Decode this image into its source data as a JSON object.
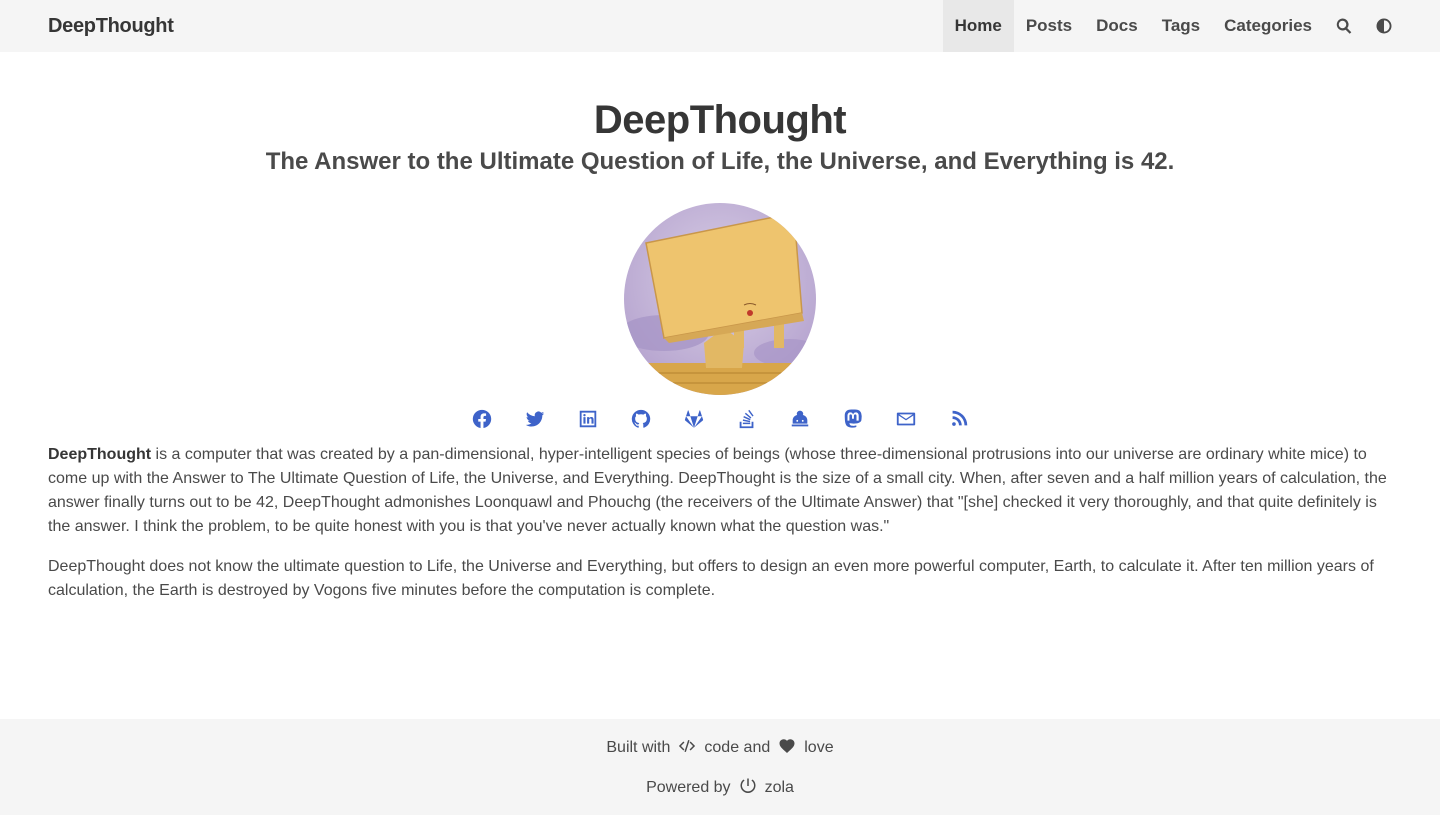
{
  "navbar": {
    "brand": "DeepThought",
    "items": [
      {
        "label": "Home",
        "active": true
      },
      {
        "label": "Posts"
      },
      {
        "label": "Docs"
      },
      {
        "label": "Tags"
      },
      {
        "label": "Categories"
      }
    ],
    "icons": [
      "search-icon",
      "theme-toggle-icon"
    ]
  },
  "hero": {
    "title": "DeepThought",
    "subtitle": "The Answer to the Ultimate Question of Life, the Universe, and Everything is 42."
  },
  "social": [
    "facebook-icon",
    "twitter-icon",
    "linkedin-icon",
    "github-icon",
    "gitlab-icon",
    "stackoverflow-icon",
    "ko-fi-icon",
    "mastodon-icon",
    "email-icon",
    "rss-icon"
  ],
  "content": {
    "p1_bold": "DeepThought",
    "p1_rest": " is a computer that was created by a pan-dimensional, hyper-intelligent species of beings (whose three-dimensional protrusions into our universe are ordinary white mice) to come up with the Answer to The Ultimate Question of Life, the Universe, and Everything. DeepThought is the size of a small city. When, after seven and a half million years of calculation, the answer finally turns out to be 42, DeepThought admonishes Loonquawl and Phouchg (the receivers of the Ultimate Answer) that \"[she] checked it very thoroughly, and that quite definitely is the answer. I think the problem, to be quite honest with you is that you've never actually known what the question was.\"",
    "p2": "DeepThought does not know the ultimate question to Life, the Universe and Everything, but offers to design an even more powerful computer, Earth, to calculate it. After ten million years of calculation, the Earth is destroyed by Vogons five minutes before the computation is complete."
  },
  "footer": {
    "built_with": "Built with",
    "code": "code and",
    "love": "love",
    "powered_by": "Powered by",
    "zola": "zola"
  },
  "colors": {
    "accent": "#3e63c9",
    "navbar_bg": "#f5f5f5",
    "text": "#4a4a4a"
  }
}
